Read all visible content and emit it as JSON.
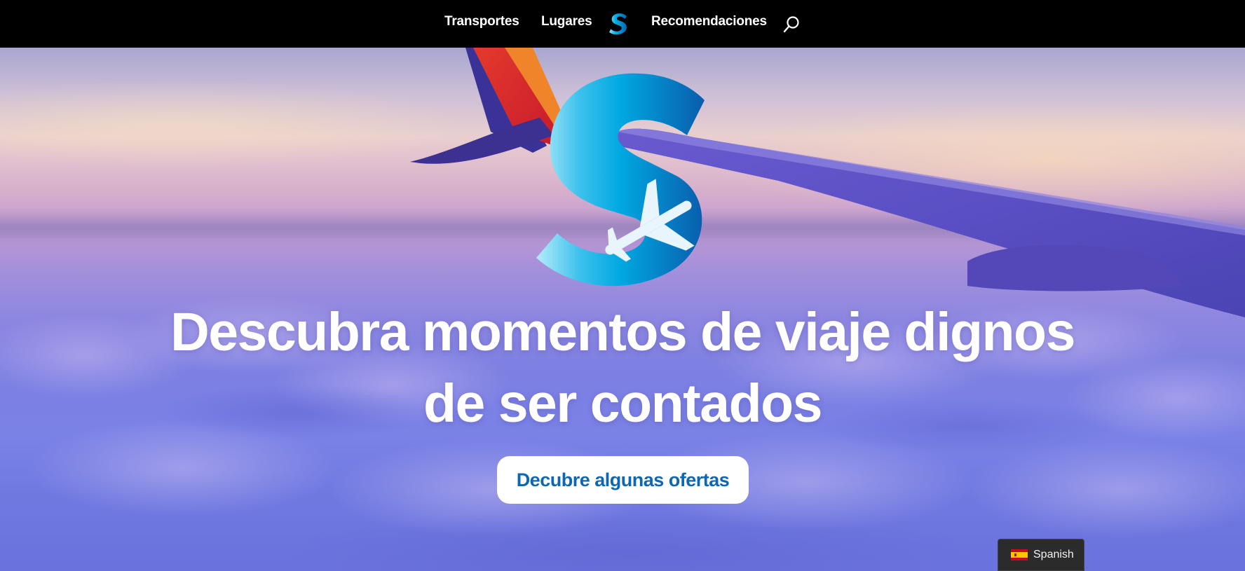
{
  "nav": {
    "items": [
      {
        "label": "Transportes"
      },
      {
        "label": "Lugares"
      },
      {
        "label": "Recomendaciones"
      }
    ],
    "logo_icon": "s-plane-logo-icon",
    "search_icon": "search-icon"
  },
  "hero": {
    "headline_line1": "Descubra momentos de viaje dignos",
    "headline_line2": "de ser contados",
    "cta_label": "Decubre algunas ofertas",
    "logo_icon": "s-plane-logo-icon"
  },
  "language": {
    "label": "Spanish",
    "flag_icon": "spain-flag-icon"
  },
  "colors": {
    "nav_bg": "#000000",
    "cta_text": "#0d67b1",
    "cta_bg": "#ffffff",
    "logo_blue": "#00a6e0",
    "logo_dark": "#0a5aa8",
    "headline": "#ffffff"
  }
}
